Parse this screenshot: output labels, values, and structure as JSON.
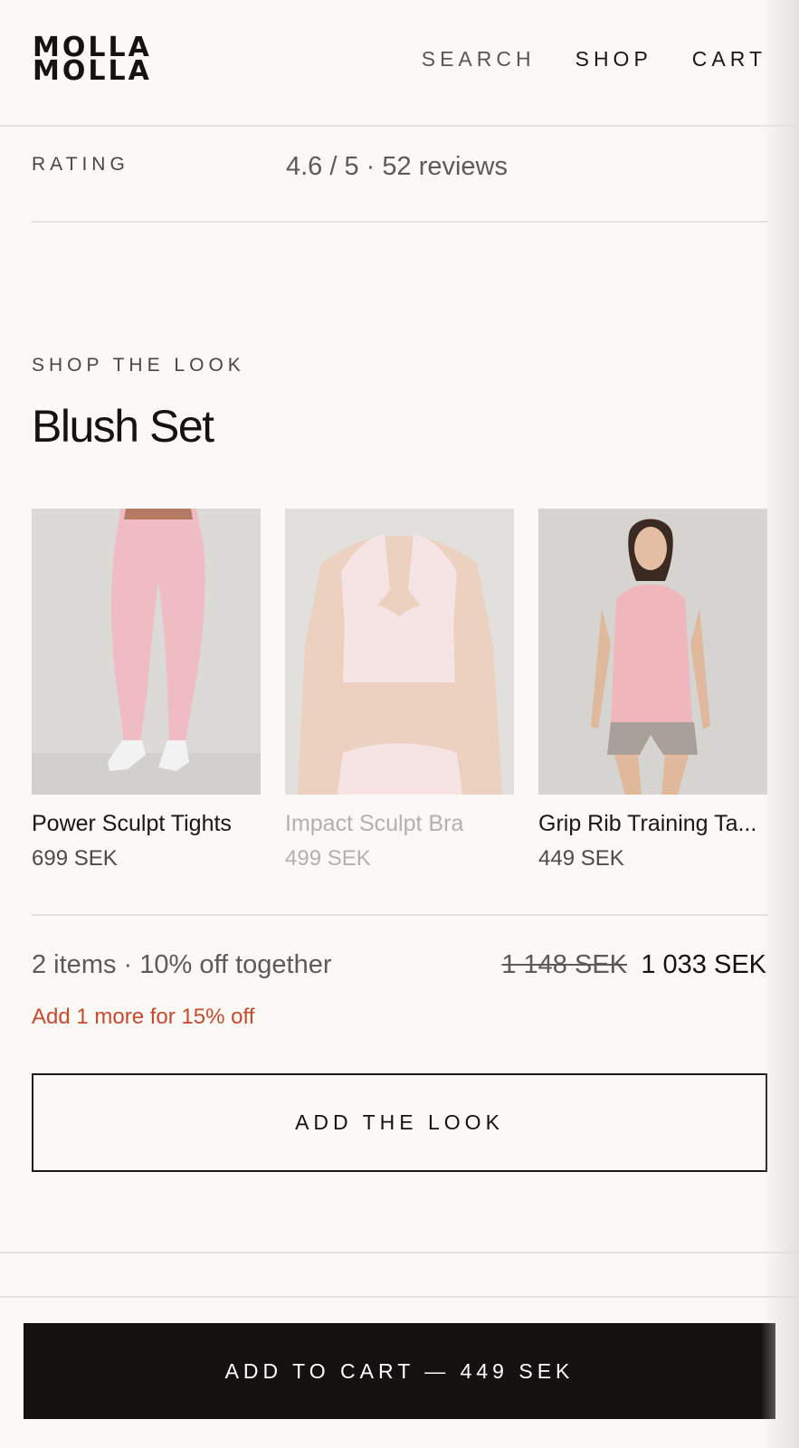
{
  "brand": {
    "line1": "MOLLA",
    "line2": "MOLLA"
  },
  "nav": {
    "search": "SEARCH",
    "shop": "SHOP",
    "cart": "CART"
  },
  "rating": {
    "label": "RATING",
    "value": "4.6 / 5 · 52 reviews"
  },
  "look": {
    "eyebrow": "SHOP THE LOOK",
    "title": "Blush Set",
    "products": [
      {
        "name": "Power Sculpt Tights",
        "price": "699 SEK",
        "selected": true
      },
      {
        "name": "Impact Sculpt Bra",
        "price": "499 SEK",
        "selected": false
      },
      {
        "name": "Grip Rib Training Ta...",
        "price": "449 SEK",
        "selected": true
      }
    ],
    "bundle_text": "2 items · 10% off together",
    "old_price": "1 148 SEK",
    "new_price": "1 033 SEK",
    "upsell": "Add 1 more for 15% off",
    "add_button": "ADD THE LOOK"
  },
  "cart_button": "ADD TO CART — 449 SEK",
  "colors": {
    "background": "#faf9f6",
    "ink": "#161212",
    "accent": "#c8492c"
  }
}
